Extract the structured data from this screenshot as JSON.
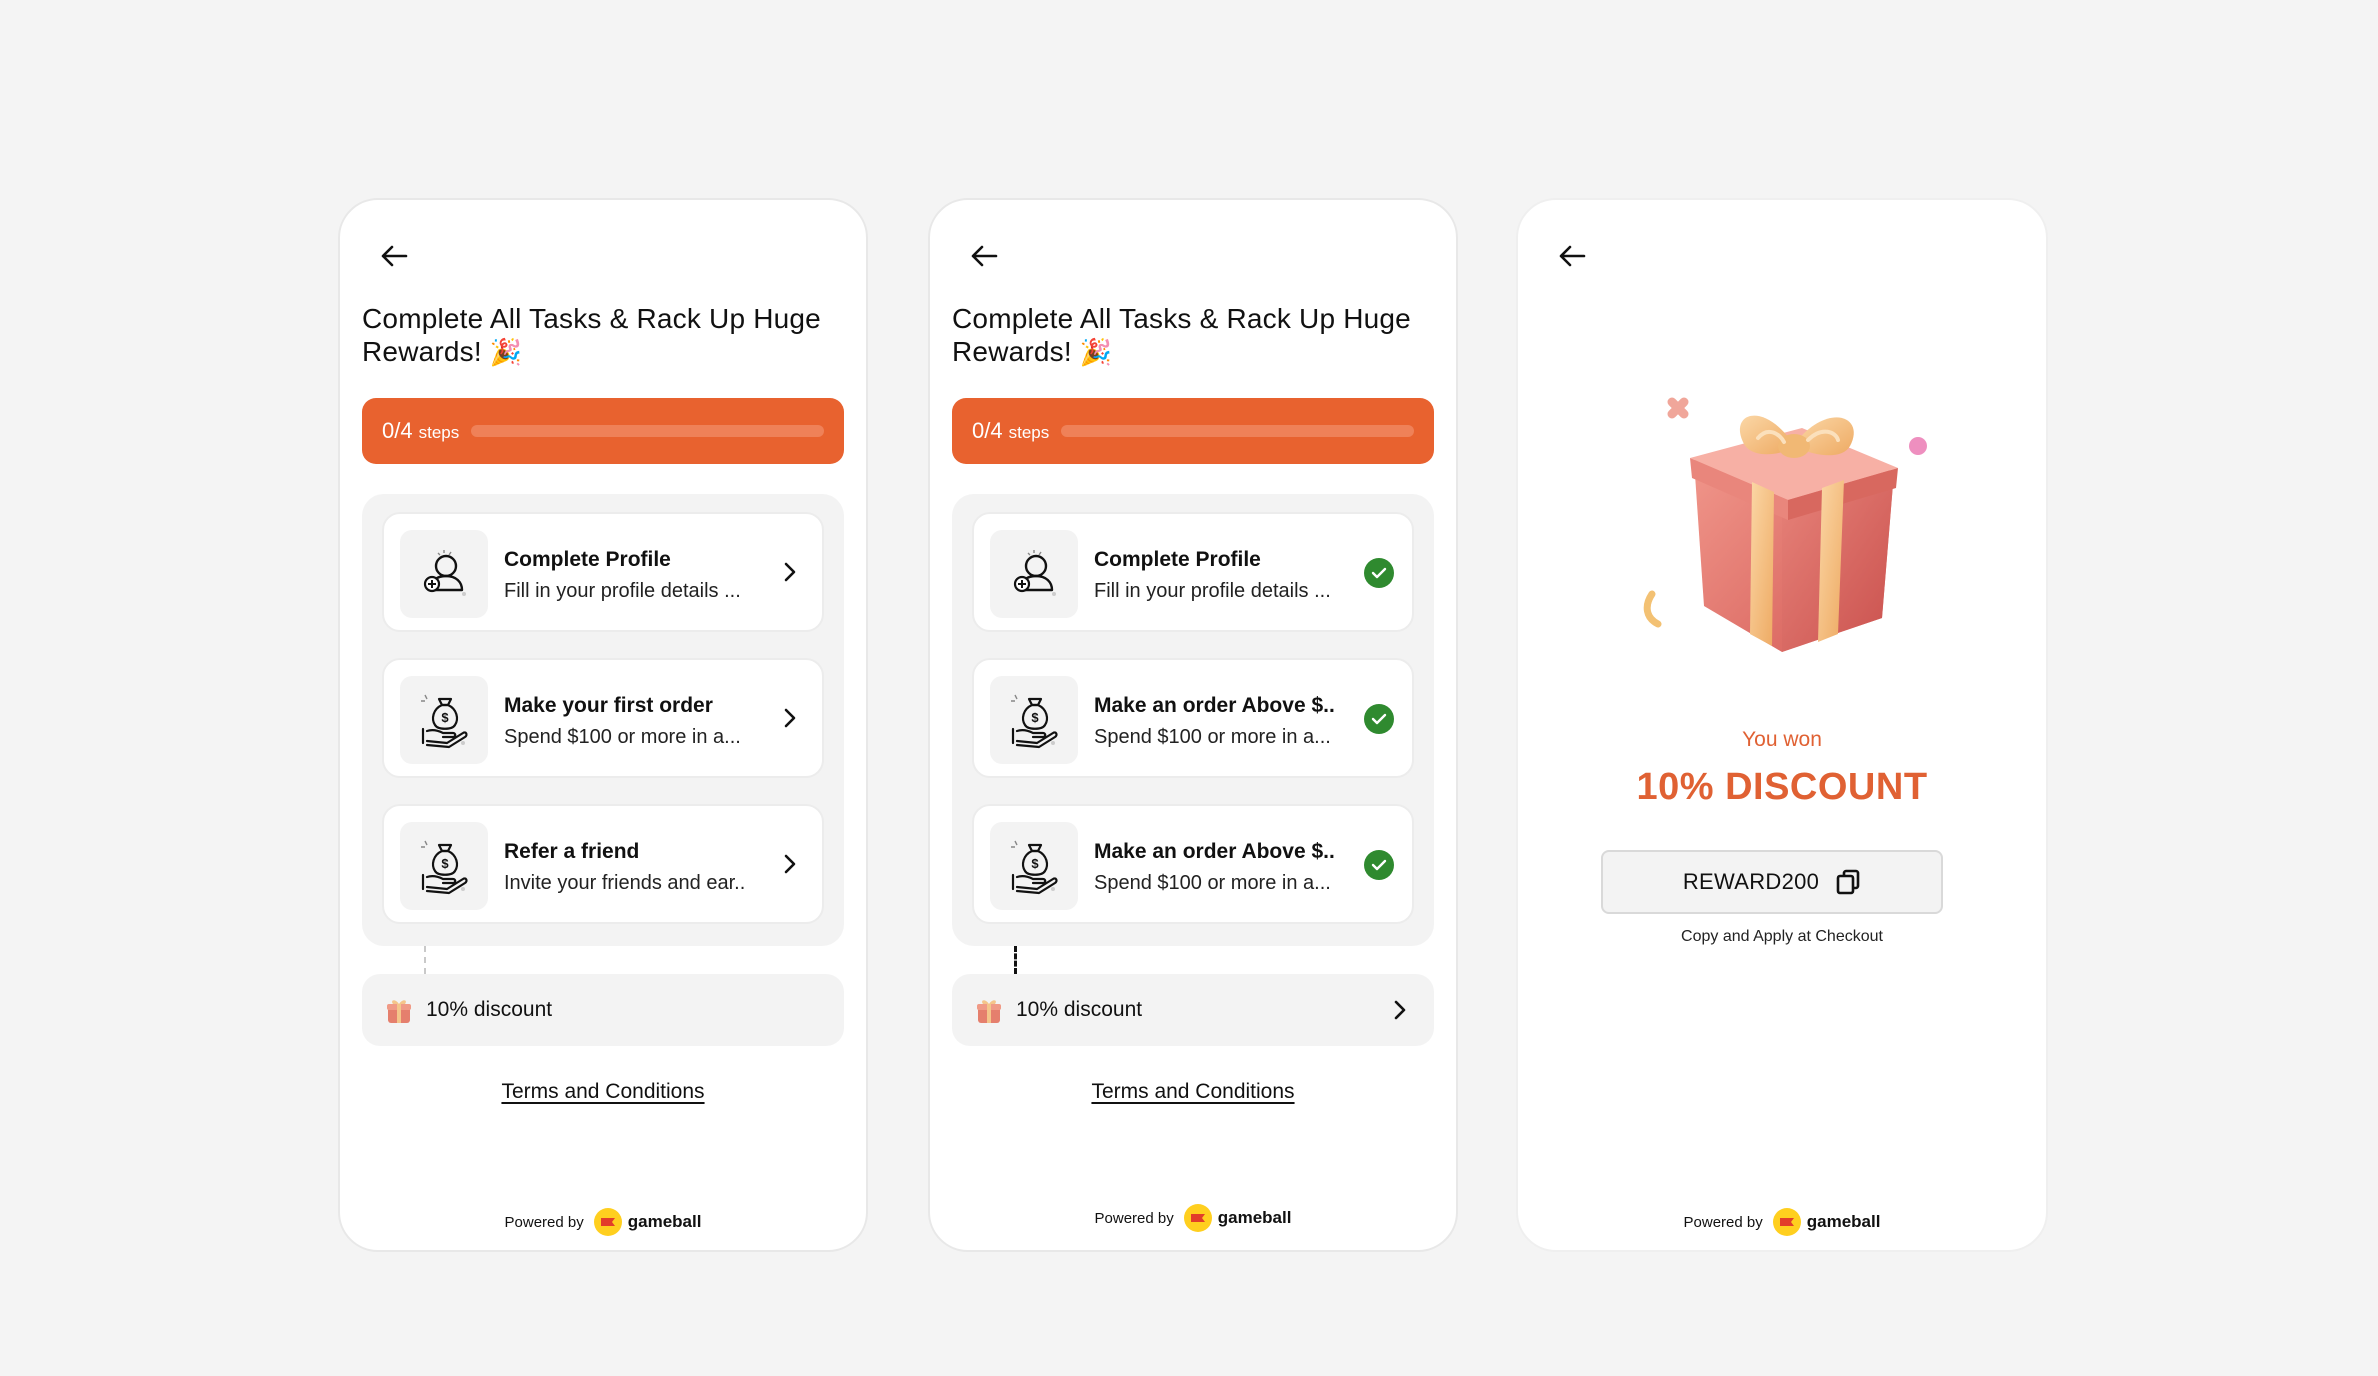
{
  "common": {
    "title_line1": "Complete All Tasks & Rack Up Huge",
    "title_line2": "Rewards!",
    "title_emoji": "🎉",
    "progress_count": "0/4",
    "progress_unit": "steps",
    "progress_fraction": 0,
    "reward_label": "10% discount",
    "terms": "Terms and Conditions",
    "powered_by": "Powered by",
    "brand": "gameball",
    "colors": {
      "accent": "#e8622f",
      "success": "#2f8a2f",
      "card": "#ffffff",
      "panel": "#f3f3f3"
    }
  },
  "screen1": {
    "tasks": [
      {
        "name": "Complete Profile",
        "desc": "Fill in your profile details ...",
        "icon": "add-user-icon",
        "state": "pending"
      },
      {
        "name": "Make your first order",
        "desc": "Spend $100 or more in a...",
        "icon": "money-bag-hand-icon",
        "state": "pending"
      },
      {
        "name": "Refer a friend",
        "desc": "Invite your friends and ear..",
        "icon": "money-bag-hand-icon",
        "state": "pending"
      }
    ]
  },
  "screen2": {
    "tasks": [
      {
        "name": "Complete Profile",
        "desc": "Fill in your profile details ...",
        "icon": "add-user-icon",
        "state": "done"
      },
      {
        "name": "Make an order Above $..",
        "desc": "Spend $100 or more in a...",
        "icon": "money-bag-hand-icon",
        "state": "done"
      },
      {
        "name": "Make an order Above $..",
        "desc": "Spend $100 or more in a...",
        "icon": "money-bag-hand-icon",
        "state": "done"
      }
    ]
  },
  "screen3": {
    "you_won": "You won",
    "discount": "10% DISCOUNT",
    "code": "REWARD200",
    "hint": "Copy and Apply at Checkout",
    "illustration": "gift-box-icon"
  }
}
